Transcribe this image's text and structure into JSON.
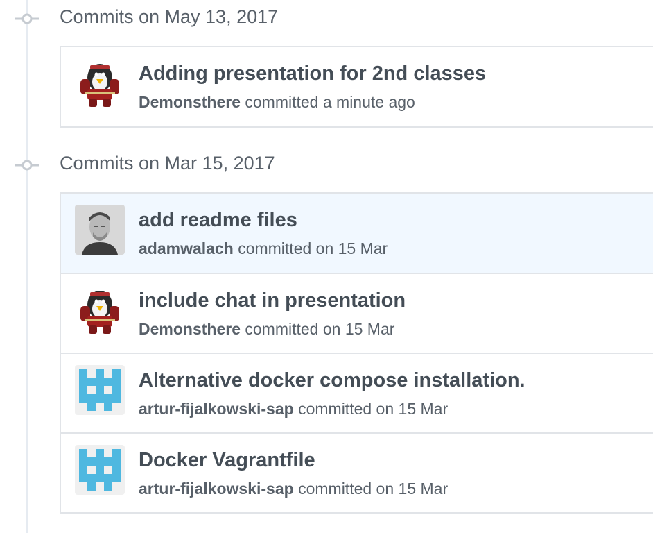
{
  "groups": [
    {
      "title": "Commits on May 13, 2017",
      "commits": [
        {
          "message": "Adding presentation for 2nd classes",
          "author": "Demonsthere",
          "meta": "committed a minute ago",
          "avatar": "penguin-avatar"
        }
      ]
    },
    {
      "title": "Commits on Mar 15, 2017",
      "commits": [
        {
          "message": "add readme files",
          "author": "adamwalach",
          "meta": "committed on 15 Mar",
          "avatar": "photo-avatar"
        },
        {
          "message": "include chat in presentation",
          "author": "Demonsthere",
          "meta": "committed on 15 Mar",
          "avatar": "penguin-avatar"
        },
        {
          "message": "Alternative docker compose installation.",
          "author": "artur-fijalkowski-sap",
          "meta": "committed on 15 Mar",
          "avatar": "identicon-avatar"
        },
        {
          "message": "Docker Vagrantfile",
          "author": "artur-fijalkowski-sap",
          "meta": "committed on 15 Mar",
          "avatar": "identicon-avatar"
        }
      ]
    }
  ],
  "colors": {
    "highlight": "#f1f8ff",
    "identicon": "#4fb8e0",
    "timeline": "#e6ebf1"
  }
}
